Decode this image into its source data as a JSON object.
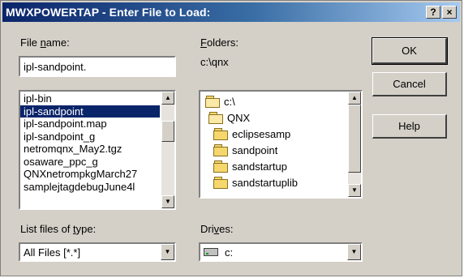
{
  "window": {
    "title": "MWXPOWERTAP - Enter File to Load:",
    "help_button": "?",
    "close_button": "×"
  },
  "file_name": {
    "label_pre": "File ",
    "label_underlined": "n",
    "label_post": "ame:",
    "value": "ipl-sandpoint.",
    "items": [
      "ipl-bin",
      "ipl-sandpoint",
      "ipl-sandpoint.map",
      "ipl-sandpoint_g",
      "netromqnx_May2.tgz",
      "osaware_ppc_g",
      "QNXnetrompkgMarch27",
      "samplejtagdebugJune4l"
    ],
    "selected_index": 1
  },
  "folders": {
    "label_underlined": "F",
    "label_post": "olders:",
    "current_path": "c:\\qnx",
    "items": [
      {
        "name": "c:\\",
        "icon": "open-folder-icon"
      },
      {
        "name": "QNX",
        "icon": "open-folder-icon"
      },
      {
        "name": "eclipsesamp",
        "icon": "folder-icon"
      },
      {
        "name": "sandpoint",
        "icon": "folder-icon"
      },
      {
        "name": "sandstartup",
        "icon": "folder-icon"
      },
      {
        "name": "sandstartuplib",
        "icon": "folder-icon"
      }
    ]
  },
  "file_type": {
    "label_pre": "List files of ",
    "label_underlined": "t",
    "label_post": "ype:",
    "value": "All Files  [*.*]"
  },
  "drives": {
    "label_pre": "Dri",
    "label_underlined": "v",
    "label_post": "es:",
    "value": "c:",
    "icon": "drive-icon"
  },
  "buttons": {
    "ok": "OK",
    "cancel": "Cancel",
    "help": "Help"
  },
  "colors": {
    "title_bar_start": "#0a246a",
    "title_bar_end": "#a6caf0",
    "selection": "#0a246a",
    "dialog_face": "#d4d0c8"
  }
}
